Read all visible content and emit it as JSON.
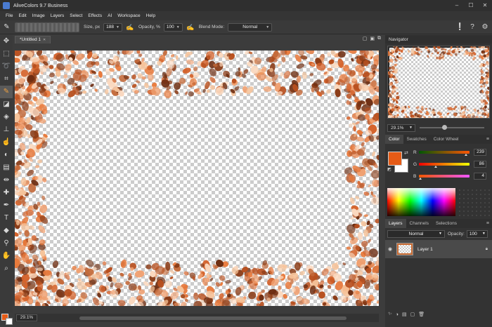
{
  "window": {
    "title": "AliveColors 9.7 Business",
    "controls": [
      "–",
      "☐",
      "✕"
    ]
  },
  "menu": [
    "File",
    "Edit",
    "Image",
    "Layers",
    "Select",
    "Effects",
    "AI",
    "Workspace",
    "Help"
  ],
  "options": {
    "size_label": "Size, px",
    "size_value": "188",
    "opacity_label": "Opacity, %",
    "opacity_value": "100",
    "blend_label": "Blend Mode:",
    "blend_value": "Normal"
  },
  "document": {
    "tab_title": "*Untitled 1",
    "zoom": "29.1%"
  },
  "navigator": {
    "title": "Navigator",
    "zoom": "29.1%"
  },
  "color_panel": {
    "tabs": [
      "Color",
      "Swatches",
      "Color Wheel"
    ],
    "r_label": "R",
    "r_value": "239",
    "g_label": "G",
    "g_value": "86",
    "b_label": "B",
    "b_value": "4",
    "foreground": "#ef5604",
    "background": "#ffffff"
  },
  "layers_panel": {
    "tabs": [
      "Layers",
      "Channels",
      "Selections"
    ],
    "blend_mode": "Normal",
    "opacity_label": "Opacity:",
    "opacity_value": "100",
    "layer_name": "Layer 1"
  },
  "icons": {
    "tools": [
      "move-icon",
      "marquee-icon",
      "lasso-icon",
      "crop-icon",
      "brush-icon",
      "eraser-icon",
      "bucket-icon",
      "stamp-icon",
      "smudge-icon",
      "dodge-icon",
      "line-icon",
      "mirror-icon",
      "healing-icon",
      "pen-icon",
      "text-icon",
      "shape-icon",
      "eyedropper-icon",
      "hand-icon",
      "zoom-icon"
    ]
  }
}
